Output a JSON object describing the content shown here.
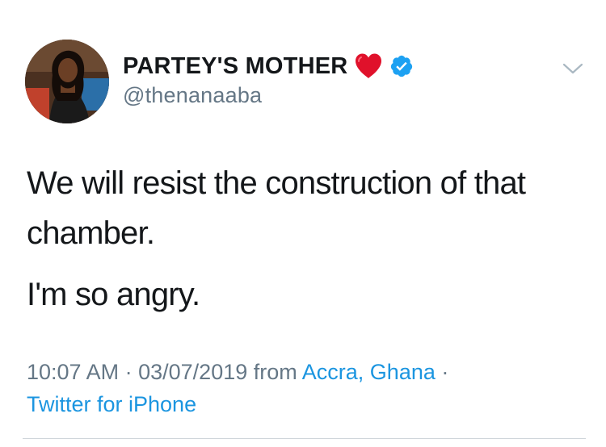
{
  "user": {
    "display_name": "PARTEY'S MOTHER",
    "handle": "@thenanaaba",
    "name_emoji": "heart-icon",
    "verified": true
  },
  "tweet": {
    "paragraphs": [
      "We will resist the construction of that chamber.",
      "I'm so angry."
    ]
  },
  "meta": {
    "time": "10:07 AM",
    "separator": "·",
    "date": "03/07/2019",
    "from_label": "from",
    "location": "Accra, Ghana",
    "source": "Twitter for iPhone"
  },
  "icons": {
    "menu": "chevron-down-icon",
    "verified": "verified-badge-icon",
    "heart": "heart-icon"
  },
  "colors": {
    "text": "#14171a",
    "secondary": "#657786",
    "link": "#1b95e0",
    "verified": "#1da1f2",
    "heart": "#e0112b",
    "divider": "#d0d6db"
  }
}
